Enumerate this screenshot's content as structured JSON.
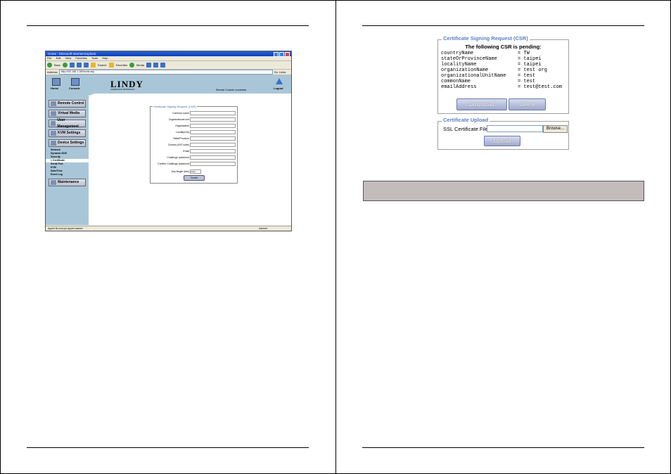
{
  "left_page": {
    "screenshot": {
      "window_title": "Home - Microsoft Internet Explorer",
      "menu": [
        "File",
        "Edit",
        "View",
        "Favorites",
        "Tools",
        "Help"
      ],
      "toolbar": {
        "back": "Back",
        "search": "Search",
        "favorites": "Favorites",
        "media": "Media"
      },
      "address_label": "Address",
      "address_value": "http://192.168.1.180/home.asp",
      "go_label": "Go",
      "links_label": "Links",
      "header": {
        "home_label": "Home",
        "console_label": "Console",
        "logo": "LINDY",
        "logo_tagline": "CONNECTION TECHNOLOGY",
        "status": "Remote Console connected",
        "logout_label": "Logout"
      },
      "sidebar": {
        "remote_control": "Remote Control",
        "virtual_media": "Virtual Media",
        "user_management": "User Management",
        "kvm_settings": "KVM Settings",
        "device_settings": "Device Settings",
        "sub_items": [
          "Network",
          "Dynamic DNS",
          "Security",
          "» Certificate",
          "Serial Port",
          "KVM",
          "Date/Time",
          "Event Log"
        ],
        "maintenance": "Maintenance"
      },
      "csr_form": {
        "legend": "Certificate Signing Request (CSR)",
        "fields": [
          "Common name",
          "Organizational unit",
          "Organization",
          "Locality/City",
          "State/Province",
          "Country (ISO code)",
          "Email",
          "Challenge password",
          "Confirm Challenge password"
        ],
        "key_length_label": "Key length (bits)",
        "key_length_value": "1024",
        "create_button": "Create"
      },
      "statusbar": {
        "left": "Applet lib.mod.jar Applet started",
        "right": "Internet"
      }
    }
  },
  "right_page": {
    "csr_panel": {
      "legend": "Certificate Signing Request (CSR)",
      "pending_title": "The following CSR is pending:",
      "rows": [
        {
          "key": "countryName",
          "value": "= TW"
        },
        {
          "key": "stateOrProvinceName",
          "value": "= taipei"
        },
        {
          "key": "localityName",
          "value": "= taipei"
        },
        {
          "key": "organizationName",
          "value": "= test org"
        },
        {
          "key": "organizationalUnitName",
          "value": "= test"
        },
        {
          "key": "commonName",
          "value": "= test"
        },
        {
          "key": "emailAddress",
          "value": "= test@test.com"
        }
      ],
      "download_button": "Download",
      "delete_button": "Delete"
    },
    "upload_panel": {
      "legend": "Certificate Upload",
      "file_label": "SSL Certificate File",
      "browse_button": "Browse...",
      "upload_button": "Upload"
    }
  }
}
